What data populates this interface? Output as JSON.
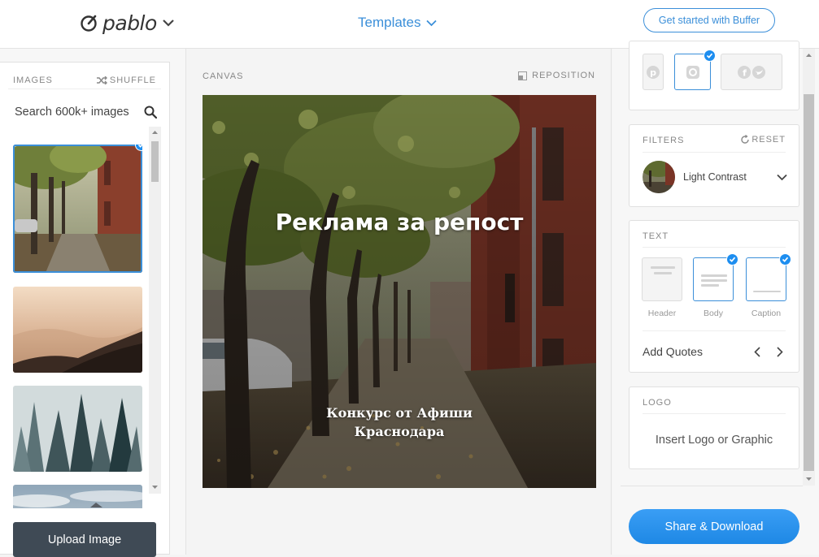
{
  "header": {
    "logo_text": "pablo",
    "templates_label": "Templates",
    "cta_label": "Get started with Buffer"
  },
  "left_panel": {
    "title": "IMAGES",
    "shuffle_label": "SHUFFLE",
    "search_placeholder": "Search 600k+ images",
    "images": [
      {
        "name": "autumn-street-thumbnail",
        "selected": true
      },
      {
        "name": "foggy-mountains-thumbnail",
        "selected": false
      },
      {
        "name": "misty-forest-thumbnail",
        "selected": false
      },
      {
        "name": "sky-thumbnail",
        "selected": false
      }
    ],
    "upload_label": "Upload Image"
  },
  "canvas": {
    "label": "CANVAS",
    "reposition_label": "REPOSITION",
    "headline": "Реклама за репост",
    "body_text": "Конкурс от Афиши Краснодара"
  },
  "right_panel": {
    "size_options": [
      {
        "name": "pinterest-size",
        "icon": "pinterest-icon",
        "selected": false
      },
      {
        "name": "instagram-size",
        "icon": "instagram-icon",
        "selected": true
      },
      {
        "name": "facebook-twitter-size",
        "icon": "facebook-twitter-icon",
        "selected": false
      }
    ],
    "filters": {
      "title": "FILTERS",
      "reset_label": "RESET",
      "selected": "Light Contrast"
    },
    "text": {
      "title": "TEXT",
      "options": [
        {
          "label": "Header",
          "selected": false
        },
        {
          "label": "Body",
          "selected": true
        },
        {
          "label": "Caption",
          "selected": true
        }
      ],
      "add_quotes_label": "Add Quotes"
    },
    "logo": {
      "title": "LOGO",
      "insert_label": "Insert Logo or Graphic"
    },
    "share_label": "Share & Download"
  },
  "colors": {
    "accent": "#3b8fd9",
    "check": "#1d8ef0",
    "upload_bg": "#3f4a55"
  }
}
